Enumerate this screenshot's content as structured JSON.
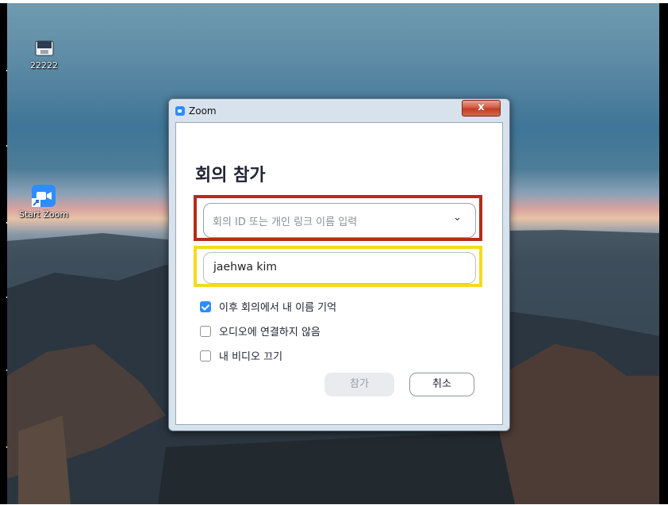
{
  "desktop": {
    "icons": [
      {
        "name": "22222"
      },
      {
        "name": "Start Zoom"
      }
    ]
  },
  "dialog": {
    "title": "Zoom",
    "close_label": "x",
    "heading": "회의 참가",
    "meeting_id": {
      "placeholder": "회의 ID 또는 개인 링크 이름 입력",
      "chevron": "⌄"
    },
    "name_field": {
      "value": "jaehwa kim"
    },
    "options": [
      {
        "label": "이후 회의에서 내 이름 기억",
        "checked": true
      },
      {
        "label": "오디오에 연결하지 않음",
        "checked": false
      },
      {
        "label": "내 비디오 끄기",
        "checked": false
      }
    ],
    "join_label": "참가",
    "cancel_label": "취소"
  },
  "colors": {
    "accent": "#2d8cff",
    "highlight_red": "#b52c17",
    "highlight_yellow": "#f2dc1a"
  }
}
